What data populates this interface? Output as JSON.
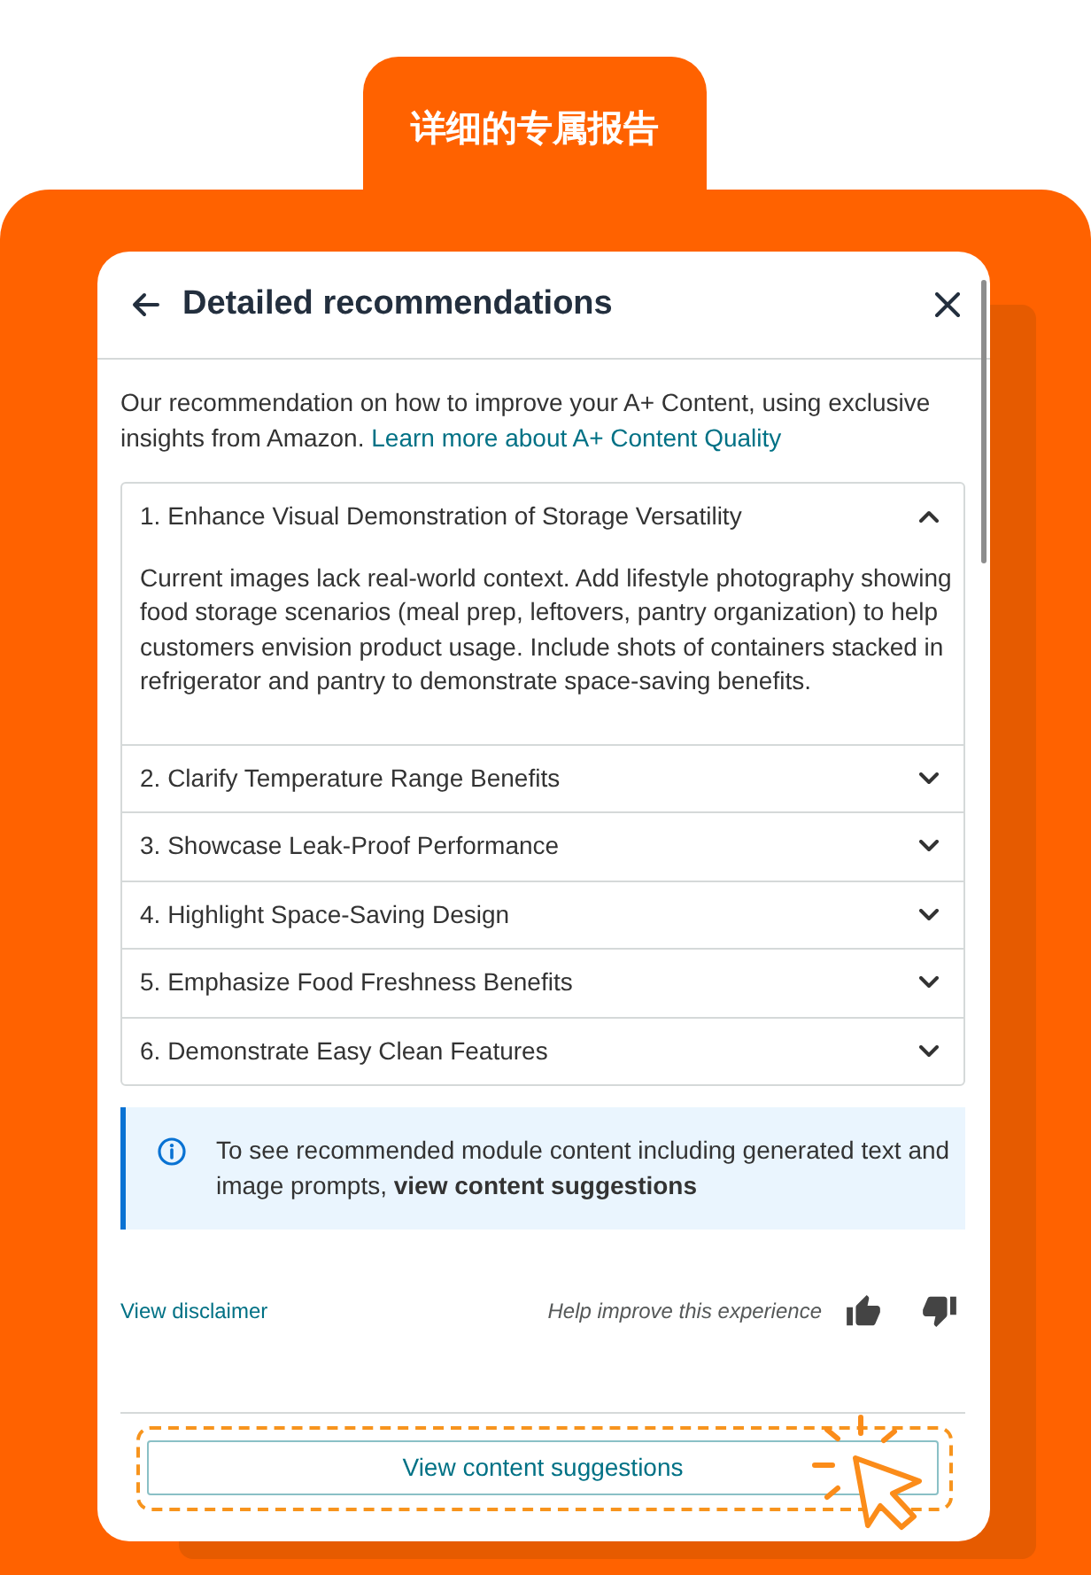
{
  "banner": {
    "title": "详细的专属报告"
  },
  "dialog": {
    "title": "Detailed recommendations"
  },
  "intro": {
    "text": "Our recommendation on how to improve your A+ Content, using exclusive insights from Amazon.",
    "link": "Learn more about A+ Content Quality"
  },
  "recommendations": [
    {
      "title": "1. Enhance Visual Demonstration of Storage Versatility",
      "expanded": true,
      "body": "Current images lack real-world context. Add lifestyle photography showing food storage scenarios (meal prep, leftovers, pantry organization) to help customers envision product usage. Include shots of containers stacked in refrigerator and pantry to demonstrate space-saving benefits."
    },
    {
      "title": "2. Clarify Temperature Range Benefits",
      "expanded": false
    },
    {
      "title": "3. Showcase Leak-Proof Performance",
      "expanded": false
    },
    {
      "title": "4. Highlight Space-Saving Design",
      "expanded": false
    },
    {
      "title": "5. Emphasize Food Freshness Benefits",
      "expanded": false
    },
    {
      "title": "6. Demonstrate Easy Clean Features",
      "expanded": false
    }
  ],
  "info_alert": {
    "text": "To see recommended module content including generated text and image prompts, **view content suggestions**"
  },
  "footer": {
    "disclaimer_link": "View disclaimer",
    "feedback_prompt": "Help improve this experience"
  },
  "primary_action": {
    "label": "View content suggestions",
    "highlighted": true
  }
}
